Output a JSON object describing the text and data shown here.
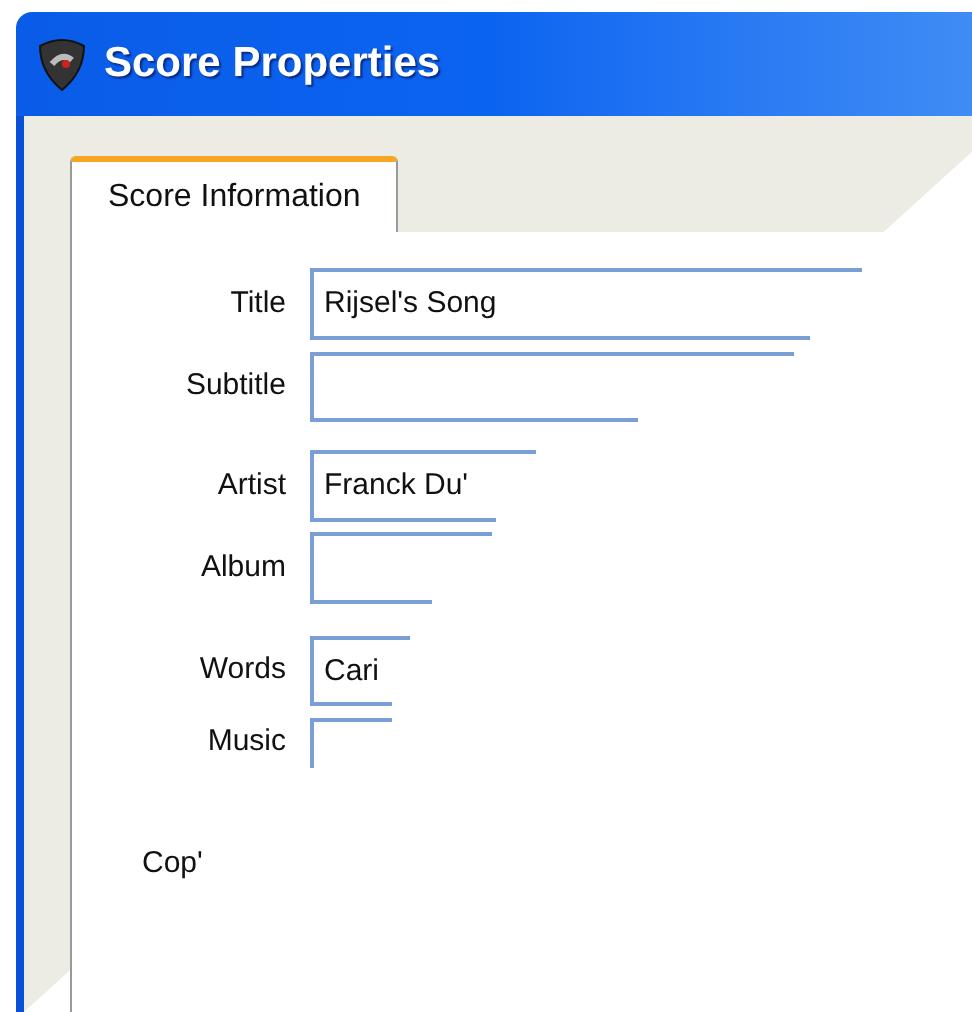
{
  "window": {
    "title": "Score Properties"
  },
  "tabs": [
    {
      "label": "Score Information",
      "selected": true
    }
  ],
  "fields": [
    {
      "label": "Title",
      "value": "Rijsel's Song"
    },
    {
      "label": "Subtitle"
    },
    {
      "label": "Artist",
      "value": "Franck Du'"
    },
    {
      "label": "Album"
    },
    {
      "label": "Words",
      "value": "Cari"
    },
    {
      "label": "Music"
    }
  ],
  "copyright_label": "Cop'"
}
